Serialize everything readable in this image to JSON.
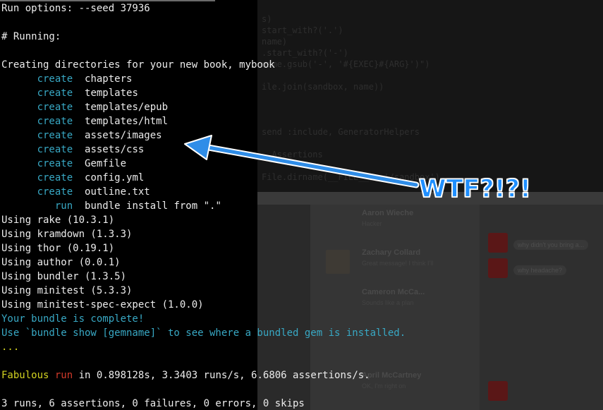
{
  "terminal": {
    "run_options": "Run options: --seed 37936",
    "running_header": "# Running:",
    "creating_message": "Creating directories for your new book, mybook",
    "create_actions": [
      {
        "action": "create",
        "path": "chapters"
      },
      {
        "action": "create",
        "path": "templates"
      },
      {
        "action": "create",
        "path": "templates/epub"
      },
      {
        "action": "create",
        "path": "templates/html"
      },
      {
        "action": "create",
        "path": "assets/images"
      },
      {
        "action": "create",
        "path": "assets/css"
      },
      {
        "action": "create",
        "path": "Gemfile"
      },
      {
        "action": "create",
        "path": "config.yml"
      },
      {
        "action": "create",
        "path": "outline.txt"
      }
    ],
    "run_action": {
      "action": "run",
      "command": "bundle install from \".\""
    },
    "gems": [
      "Using rake (10.3.1)",
      "Using kramdown (1.3.3)",
      "Using thor (0.19.1)",
      "Using author (0.0.1)",
      "Using bundler (1.3.5)",
      "Using minitest (5.3.3)",
      "Using minitest-spec-expect (1.0.0)"
    ],
    "bundle_complete": "Your bundle is complete!",
    "bundle_show_hint": "Use `bundle show [gemname]` to see where a bundled gem is installed.",
    "progress_dots": "...",
    "fabulous_word": "Fabulous",
    "run_word": "run",
    "timing": " in 0.898128s, 3.3403 runs/s, 6.6806 assertions/s.",
    "summary": "3 runs, 6 assertions, 0 failures, 0 errors, 0 skips"
  },
  "annotation": {
    "label": "WTF?!?!",
    "color": "#1f8fff"
  },
  "background_window": {
    "code_lines": [
      "s)",
      "start_with?('.')",
      "name)",
      ".start_with?('-')",
      "name.gsub('-', '#{EXEC}#{ARG}')\")",
      "",
      "ile.join(sandbox, name))",
      "",
      "",
      "send :include, GeneratorHelpers",
      "",
      "  Assertions",
      "",
      "File.dirname(__FILE__), '/sandbox')"
    ],
    "contacts": [
      {
        "name": "Aaron Wieche",
        "sub": "Hacker"
      },
      {
        "name": "Zachary Collard",
        "sub": "Great message! I think I'll"
      },
      {
        "name": "Cameron McCa...",
        "sub": "Sounds like a plan"
      },
      {
        "name": "April McCartney",
        "sub": "OK, I'm right on"
      }
    ],
    "bubbles": [
      "why didn't you bring a...",
      "why headache?"
    ]
  }
}
